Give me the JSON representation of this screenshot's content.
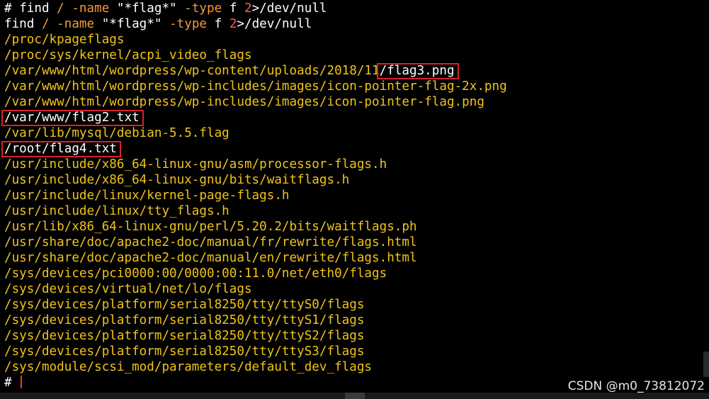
{
  "terminal": {
    "command_echo": {
      "prompt": "#",
      "cmd": "find",
      "slash": "/",
      "name_flag": "-name",
      "name_value": "\"*flag*\"",
      "type_flag": "-type",
      "type_value": "f",
      "fd": "2",
      "redirect": ">/dev/null"
    },
    "command_line": {
      "cmd": "find",
      "slash": "/",
      "name_flag": "-name",
      "name_value": "\"*flag*\"",
      "type_flag": "-type",
      "type_value": "f",
      "fd": "2",
      "redirect": ">/dev/null"
    },
    "results": [
      {
        "path": "/proc/kpageflags"
      },
      {
        "path": "/proc/sys/kernel/acpi_video_flags"
      },
      {
        "path": "/var/www/html/wordpress/wp-content/uploads/2018/11",
        "highlight": "/flag3.png"
      },
      {
        "path": "/var/www/html/wordpress/wp-includes/images/icon-pointer-flag-2x.png"
      },
      {
        "path": "/var/www/html/wordpress/wp-includes/images/icon-pointer-flag.png"
      },
      {
        "path": "",
        "highlight": "/var/www/flag2.txt"
      },
      {
        "path": "/var/lib/mysql/debian-5.5.flag"
      },
      {
        "path": "",
        "highlight": "/root/flag4.txt"
      },
      {
        "path": "/usr/include/x86_64-linux-gnu/asm/processor-flags.h"
      },
      {
        "path": "/usr/include/x86_64-linux-gnu/bits/waitflags.h"
      },
      {
        "path": "/usr/include/linux/kernel-page-flags.h"
      },
      {
        "path": "/usr/include/linux/tty_flags.h"
      },
      {
        "path": "/usr/lib/x86_64-linux-gnu/perl/5.20.2/bits/waitflags.ph"
      },
      {
        "path": "/usr/share/doc/apache2-doc/manual/fr/rewrite/flags.html"
      },
      {
        "path": "/usr/share/doc/apache2-doc/manual/en/rewrite/flags.html"
      },
      {
        "path": "/sys/devices/pci0000:00/0000:00:11.0/net/eth0/flags"
      },
      {
        "path": "/sys/devices/virtual/net/lo/flags"
      },
      {
        "path": "/sys/devices/platform/serial8250/tty/ttyS0/flags"
      },
      {
        "path": "/sys/devices/platform/serial8250/tty/ttyS1/flags"
      },
      {
        "path": "/sys/devices/platform/serial8250/tty/ttyS2/flags"
      },
      {
        "path": "/sys/devices/platform/serial8250/tty/ttyS3/flags"
      },
      {
        "path": "/sys/module/scsi_mod/parameters/default_dev_flags"
      }
    ],
    "final_prompt": "#"
  },
  "watermark": "CSDN @m0_73812072",
  "colors": {
    "background": "#000000",
    "path_text": "#f0c419",
    "command_text": "#ffffff",
    "argument_text": "#f29a3d",
    "number_text": "#ff5a5a",
    "highlight_box": "#d9222a",
    "cursor": "#ff3030"
  }
}
